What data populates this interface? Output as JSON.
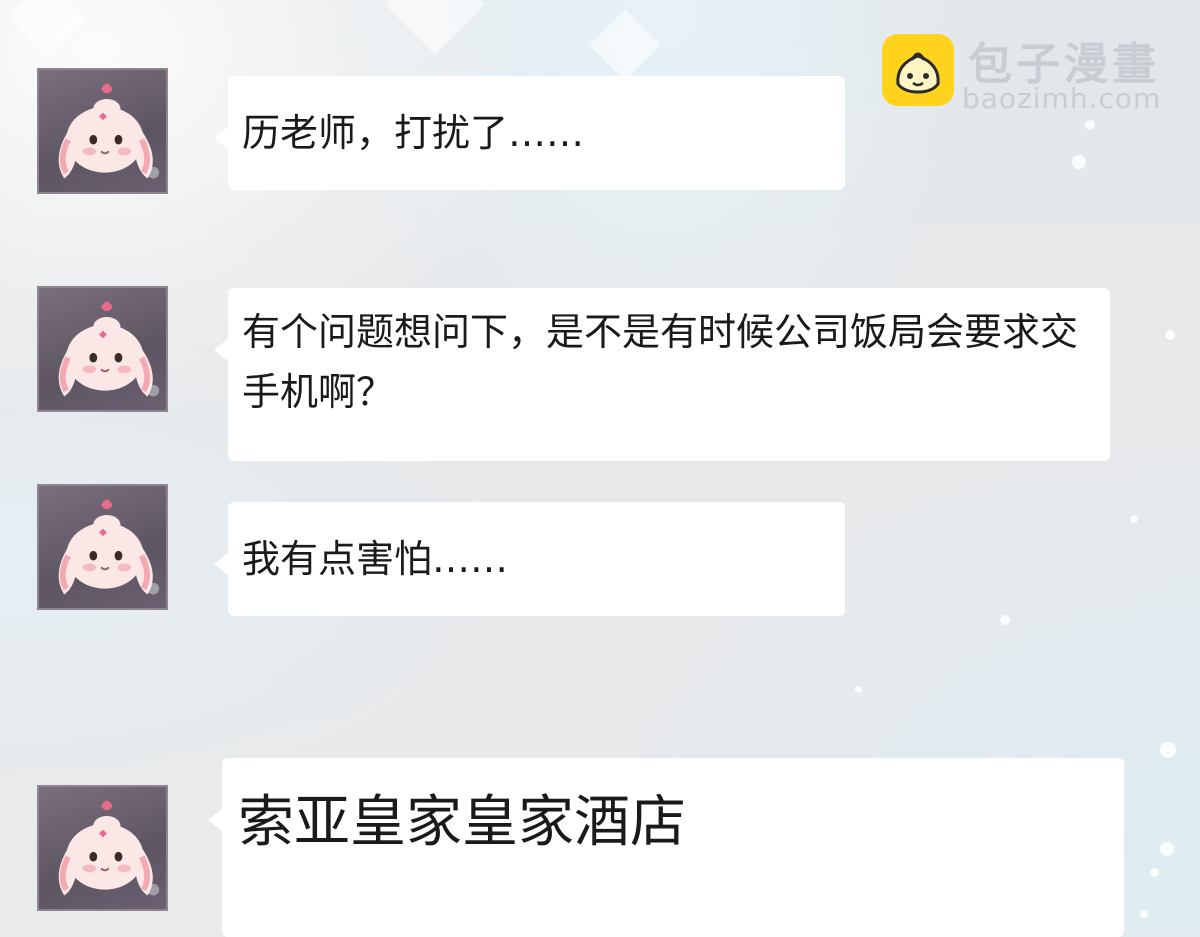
{
  "watermark": {
    "icon": "baozi-icon",
    "title": "包子漫畫",
    "url": "baozimh.com"
  },
  "messages": [
    {
      "avatar": "bunny-avatar",
      "text": "历老师，打扰了……"
    },
    {
      "avatar": "bunny-avatar",
      "text": "有个问题想问下，是不是有时候公司饭局会要求交手机啊？"
    },
    {
      "avatar": "bunny-avatar",
      "text": "我有点害怕……"
    },
    {
      "avatar": "bunny-avatar",
      "text": "索亚皇家皇家酒店"
    }
  ],
  "colors": {
    "bubble": "#ffffff",
    "text": "#1a1a1a",
    "logo_yellow": "#ffd21c"
  }
}
